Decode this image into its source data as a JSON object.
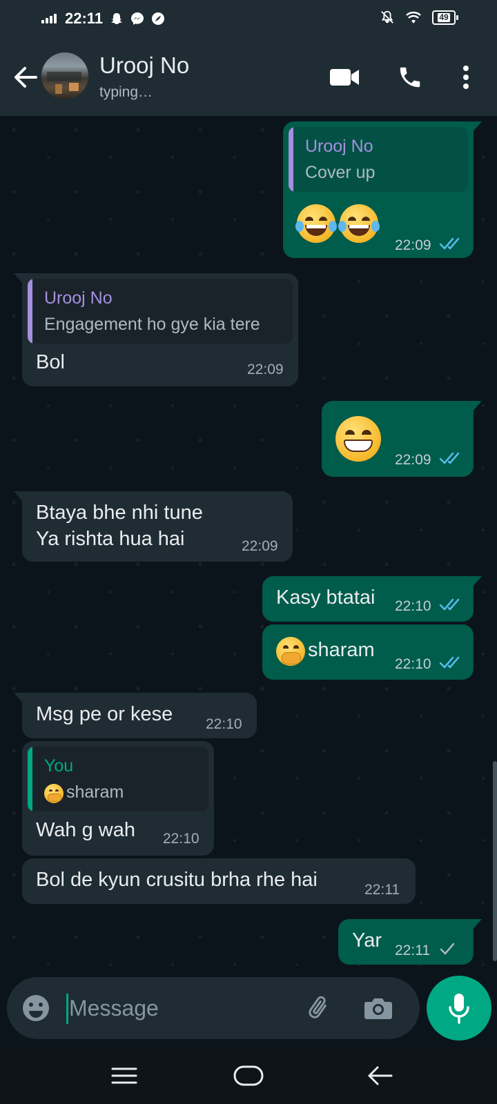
{
  "status_bar": {
    "time": "22:11",
    "battery": "49"
  },
  "header": {
    "contact_name": "Urooj No",
    "status": "typing…"
  },
  "colors": {
    "outgoing_bubble": "#005c4b",
    "incoming_bubble": "#202c33",
    "accent": "#00a884",
    "read_ticks": "#53bdeb",
    "quote_name_purple": "#a58fe0",
    "quote_name_you": "#00a884"
  },
  "messages": [
    {
      "direction": "out",
      "reply_to": {
        "name": "Urooj No",
        "text": "Cover up"
      },
      "emoji": [
        "face-with-tears-of-joy",
        "face-with-tears-of-joy"
      ],
      "time": "22:09",
      "status": "read"
    },
    {
      "direction": "in",
      "reply_to": {
        "name": "Urooj No",
        "text": "Engagement ho gye kia tere"
      },
      "text": "Bol",
      "time": "22:09"
    },
    {
      "direction": "out",
      "emoji": [
        "beaming-face"
      ],
      "time": "22:09",
      "status": "read"
    },
    {
      "direction": "in",
      "text": "Btaya bhe nhi tune\nYa rishta hua hai",
      "lines": [
        "Btaya bhe nhi tune",
        "Ya rishta hua hai"
      ],
      "time": "22:09"
    },
    {
      "direction": "out",
      "text": "Kasy btatai",
      "time": "22:10",
      "status": "read"
    },
    {
      "direction": "out",
      "emoji": [
        "face-with-hand-over-mouth"
      ],
      "text": "sharam",
      "time": "22:10",
      "status": "read"
    },
    {
      "direction": "in",
      "text": "Msg pe or kese",
      "time": "22:10"
    },
    {
      "direction": "in",
      "reply_to": {
        "name": "You",
        "emoji": "face-with-hand-over-mouth",
        "text": "sharam"
      },
      "text": "Wah g wah",
      "time": "22:10"
    },
    {
      "direction": "in",
      "text": "Bol de kyun crusitu brha rhe hai",
      "time": "22:11"
    },
    {
      "direction": "out",
      "text": "Yar",
      "time": "22:11",
      "status": "sent"
    }
  ],
  "composer": {
    "placeholder": "Message",
    "value": ""
  },
  "icons": {
    "back": "arrow-left-icon",
    "video_call": "video-camera-icon",
    "voice_call": "phone-icon",
    "menu": "more-vertical-icon",
    "emoji": "smiley-icon",
    "attach": "paperclip-icon",
    "camera": "camera-icon",
    "mic": "microphone-icon",
    "nav_recents": "menu-lines-icon",
    "nav_home": "home-pill-icon",
    "nav_back": "back-arrow-icon"
  }
}
